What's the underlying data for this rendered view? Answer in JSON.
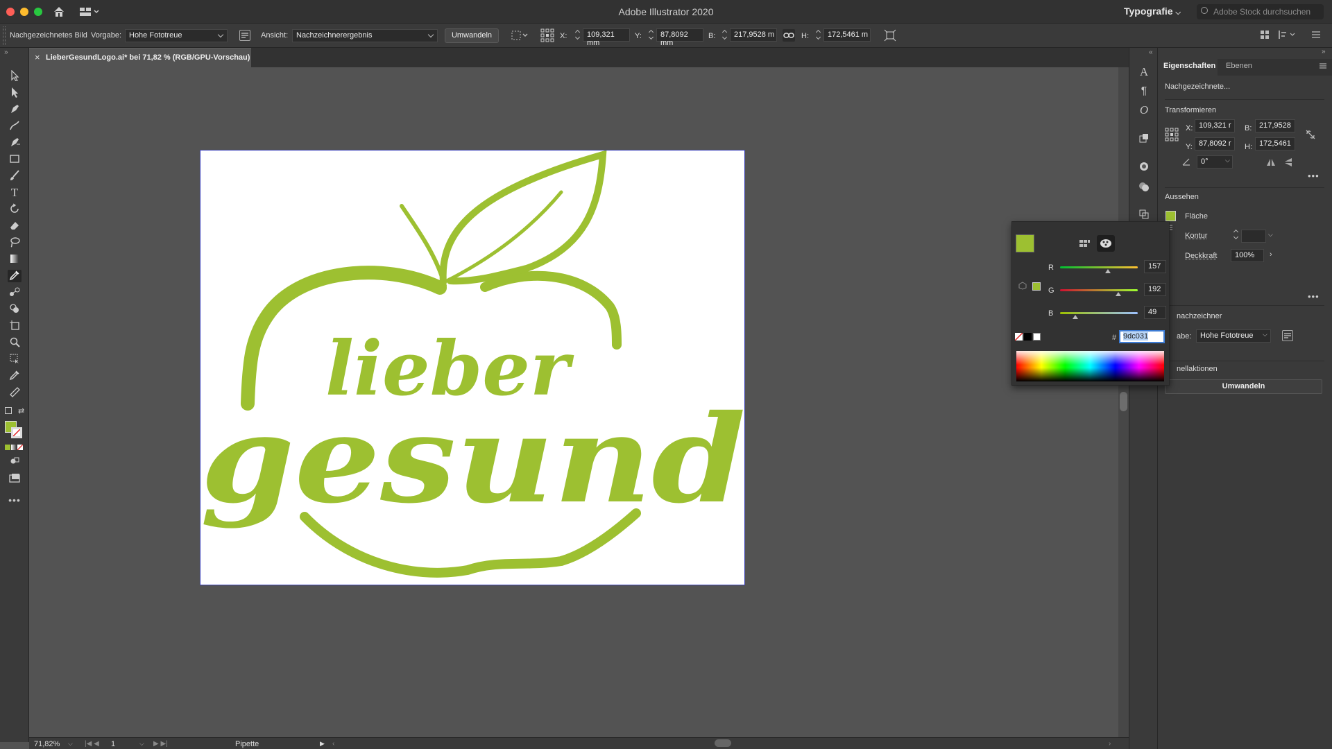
{
  "app": {
    "title": "Adobe Illustrator 2020",
    "workspace": "Typografie",
    "search_placeholder": "Adobe Stock durchsuchen"
  },
  "control_bar": {
    "selection_type": "Nachgezeichnetes Bild",
    "preset_label": "Vorgabe:",
    "preset_value": "Hohe Fototreue",
    "view_label": "Ansicht:",
    "view_value": "Nachzeichnerergebnis",
    "convert_button": "Umwandeln",
    "x_label": "X:",
    "x_value": "109,321 mm",
    "y_label": "Y:",
    "y_value": "87,8092 mm",
    "w_label": "B:",
    "w_value": "217,9528 m",
    "h_label": "H:",
    "h_value": "172,5461 m"
  },
  "document_tab": {
    "title": "LieberGesundLogo.ai* bei 71,82 % (RGB/GPU-Vorschau)"
  },
  "artwork": {
    "line1": "lieber",
    "line2": "gesund",
    "color": "#9dc031"
  },
  "status_bar": {
    "zoom": "71,82%",
    "artboard_number": "1",
    "active_tool": "Pipette"
  },
  "properties_panel": {
    "tabs": [
      "Eigenschaften",
      "Ebenen"
    ],
    "object_type": "Nachgezeichnete...",
    "transform": {
      "title": "Transformieren",
      "x_label": "X:",
      "x_value": "109,321 r",
      "y_label": "Y:",
      "y_value": "87,8092 r",
      "w_label": "B:",
      "w_value": "217,9528",
      "h_label": "H:",
      "h_value": "172,5461",
      "angle_value": "0°"
    },
    "appearance": {
      "title": "Aussehen",
      "fill_label": "Fläche",
      "stroke_label": "Kontur",
      "opacity_label": "Deckkraft",
      "opacity_value": "100%"
    },
    "trace": {
      "title": "nachzeichner",
      "preset_label": "abe:",
      "preset_value": "Hohe Fototreue"
    },
    "quick_actions": {
      "title": "nellaktionen",
      "convert_button": "Umwandeln"
    }
  },
  "color_picker": {
    "color": "#9dc031",
    "r_label": "R",
    "r_value": "157",
    "g_label": "G",
    "g_value": "192",
    "b_label": "B",
    "b_value": "49",
    "r_level": 0.616,
    "g_level": 0.753,
    "b_level": 0.192,
    "hex_prefix": "#",
    "hex_value": "9dc031"
  }
}
